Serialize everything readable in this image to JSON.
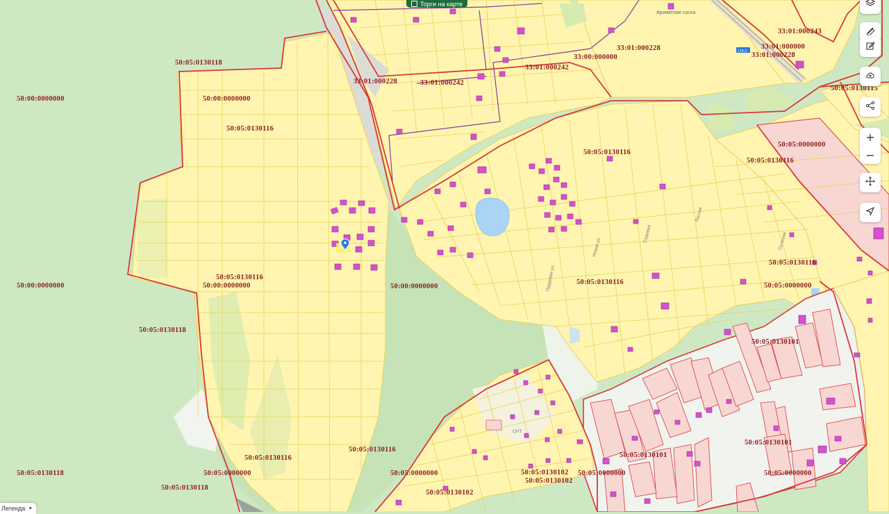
{
  "map": {
    "cadastral_labels": [
      "50:05:0130118",
      "50:00:0000000",
      "50:00:0000000",
      "50:05:0130116",
      "50:00:0000000",
      "50:05:0130116",
      "50:00:0000000",
      "50:00:0000000",
      "50:05:0130118",
      "50:05:0130116",
      "50:05:0130116",
      "50:05:0130118",
      "50:05:0000000",
      "50:05:0130118",
      "33:01:000228",
      "33:01:000242",
      "33:01:000242",
      "33:00:000000",
      "33:01:000228",
      "33:01:000243",
      "33:01:000000",
      "33:01:000228",
      "50:05:0130115",
      "50:05:0000000",
      "50:05:0130116",
      "50:05:0130116",
      "50:05:0130116",
      "50:05:0130116",
      "50:05:0000000",
      "50:05:0130101",
      "50:05:0130101",
      "50:05:0130101",
      "50:05:0000000",
      "50:05:0130102",
      "50:05:0130102",
      "50:05:0000000",
      "50:05:0130102",
      "50:05:0000000"
    ],
    "poi_label": "Ароматная сосна",
    "street_labels": [
      "Садовая",
      "Лесная",
      "Новая ул.",
      "Полевая",
      "Прудовая ул.",
      "СНТ"
    ],
    "road_number": "17А-2",
    "colors": {
      "forest": "#cfe8c4",
      "parcel_fill": "#fff5b0",
      "parcel_line": "#e6d35a",
      "boundary": "#d63a3a",
      "building": "#d94fd0",
      "water": "#a9d4f5",
      "urban_fill": "#f8d7d3"
    }
  },
  "toolbar": {
    "icons": [
      "layers-icon",
      "ruler-icon",
      "edit-icon",
      "upload-cloud-icon",
      "share-icon",
      "move-icon",
      "navigate-icon"
    ],
    "zoom_in": "+",
    "zoom_out": "−"
  },
  "torgi_toggle": {
    "label": "Торги на карте"
  },
  "legend": {
    "label": "Легенда"
  }
}
